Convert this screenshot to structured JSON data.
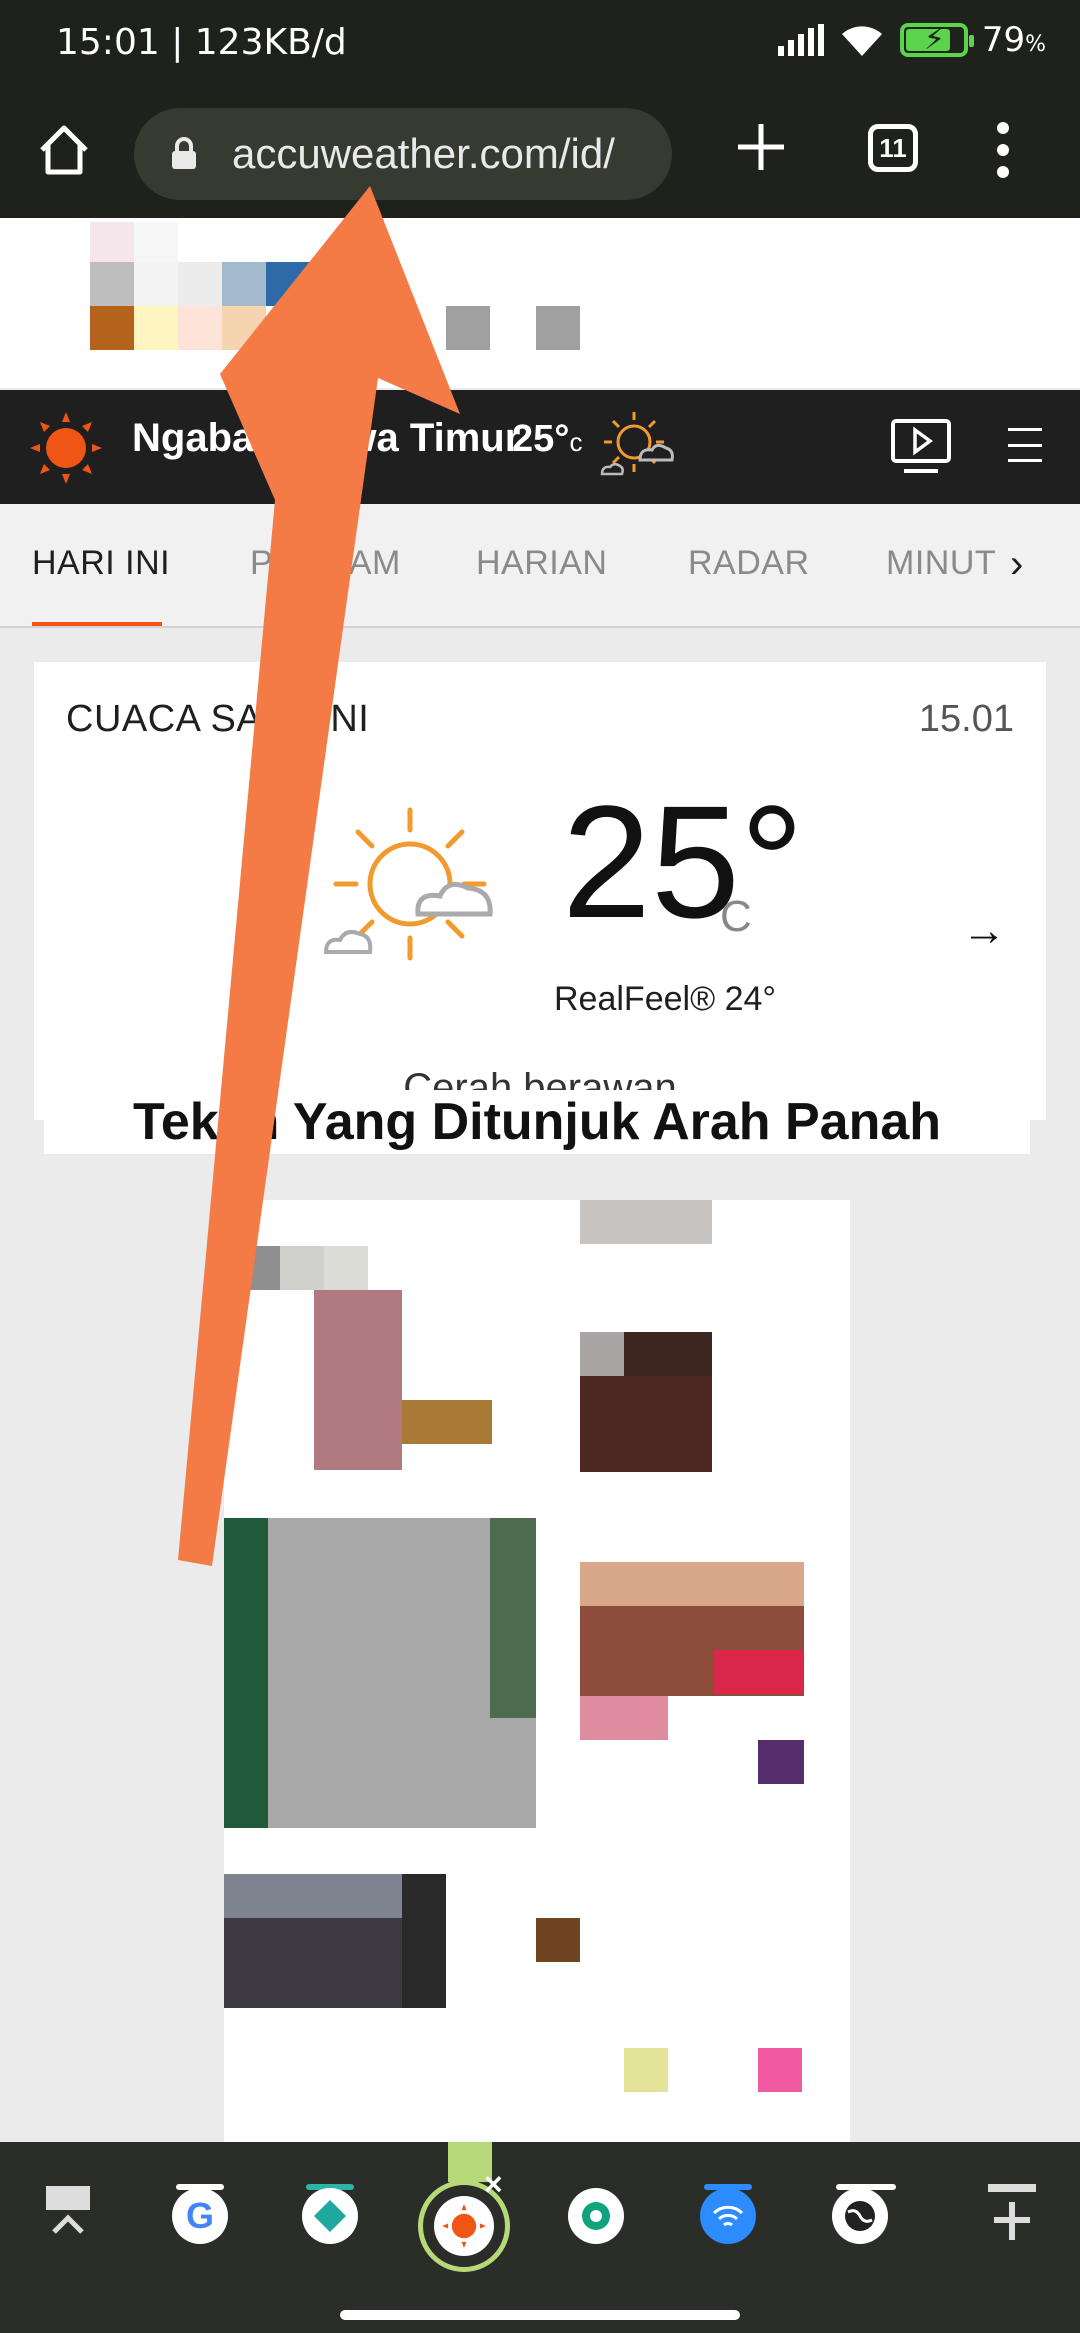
{
  "status_bar": {
    "time_speed": "15:01 | 123KB/d",
    "battery": "79",
    "battery_unit": "%",
    "battery_level": 0.79
  },
  "browser": {
    "url": "accuweather.com/id/",
    "tab_count": "11",
    "icons": [
      "home-icon",
      "lock-icon",
      "new-tab-icon",
      "tab-switcher-icon",
      "more-menu-icon"
    ]
  },
  "site_header": {
    "location": "Ngabab, Jawa Timur",
    "temp": "25°",
    "unit": "c",
    "icons": [
      "accuweather-logo-icon",
      "partly-sunny-icon",
      "video-icon",
      "menu-icon"
    ]
  },
  "nav": {
    "tabs": [
      "HARI INI",
      "PER JAM",
      "HARIAN",
      "RADAR",
      "MINUTECAST"
    ],
    "active": "HARI INI"
  },
  "current": {
    "title": "CUACA SAAT INI",
    "time": "15.01",
    "temp": "25°",
    "unit": "C",
    "realfeel_label": "RealFeel®",
    "realfeel_value": "24°",
    "phrase": "Cerah berawan",
    "arrow": "→"
  },
  "overlay": {
    "instruction": "Tekan Yang Ditunjuk Arah Panah"
  },
  "colors": {
    "accent": "#f05514",
    "arrow": "#f47b45",
    "dark": "#1f211d"
  },
  "taskbar": {
    "icons": [
      "collapse-icon",
      "google-icon",
      "app-diamond-icon",
      "accuweather-app-icon",
      "chatgpt-icon",
      "wifi-app-icon",
      "browser-app-icon",
      "add-icon"
    ]
  }
}
